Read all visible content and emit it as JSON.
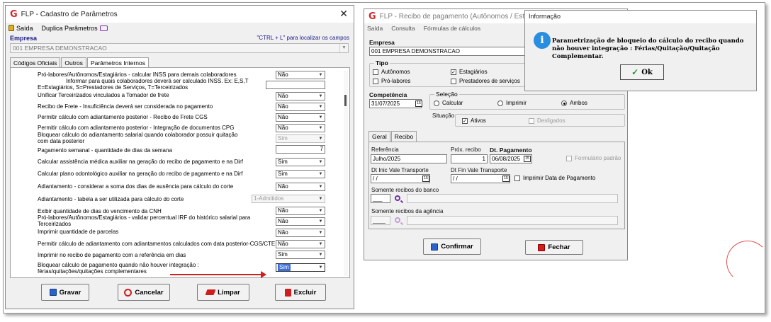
{
  "left": {
    "title": "FLP - Cadastro de Parâmetros",
    "menu": {
      "saida": "Saída",
      "duplica": "Duplica Parâmetros"
    },
    "empresa_label": "Empresa",
    "empresa_hint": "\"CTRL + L\" para localizar os campos",
    "empresa_value": "001 EMPRESA DEMONSTRACAO",
    "tabs": [
      "Códigos Oficiais",
      "Outros",
      "Parâmetros Internos"
    ],
    "rows": [
      {
        "label": "Pró-labores/Autônomos/Estagiários - calcular INSS para demais colaboradores",
        "value": "Não"
      },
      {
        "label": "Informar para quais colaboradores deverá ser calculado INSS. Ex: E,S,T",
        "value": ""
      },
      {
        "label": "E=Estagiários, S=Prestadores de Serviços, T=Terceirizados",
        "value": ""
      },
      {
        "label": "Unificar Terceirizados vinculados a Tomador de frete",
        "value": "Não"
      },
      {
        "label": "Recibo de Frete - Insuficiência deverá ser considerada no pagamento",
        "value": "Não"
      },
      {
        "label": "Permitir cálculo com adiantamento posterior - Recibo de Frete CGS",
        "value": "Não"
      },
      {
        "label": "Permitir cálculo com adiantamento posterior - Integração de documentos CPG",
        "value": "Não"
      },
      {
        "label": "Bloquear cálculo do adiantamento salarial quando colaborador possuir quitação",
        "value": "Sim"
      },
      {
        "label": "com data posterior",
        "value": ""
      },
      {
        "label": "Pagamento semanal - quantidade de dias da  semana",
        "value": "7"
      },
      {
        "label": "Calcular assistência médica auxiliar na geração do recibo de pagamento e na Dirf",
        "value": "Sim"
      },
      {
        "label": "Calcular plano odontológico auxiliar na geração do recibo de pagamento e na Dirf",
        "value": "Sim"
      },
      {
        "label": "Adiantamento - considerar a soma dos dias de ausência para cálculo do corte",
        "value": "Não"
      },
      {
        "label": "Adiantamento - tabela a ser utilizada para cálculo do corte",
        "value": "1-Admitidos"
      },
      {
        "label": "Exibir quantidade de dias do vencimento da CNH",
        "value": "Não"
      },
      {
        "label": "Pró-labores/Autônomos/Estagiários - validar percentual IRF do  histórico salarial para",
        "value": "Não"
      },
      {
        "label": "Terceirizados",
        "value": ""
      },
      {
        "label": "Imprimir quantidade de parcelas",
        "value": "Não"
      },
      {
        "label": "Permitir cálculo de adiantamento com adiantamentos calculados com data posterior-CGS/CTE",
        "value": "Não"
      },
      {
        "label": "Imprimir no recibo de pagamento com a referência em dias",
        "value": "Sim"
      },
      {
        "label": "Bloquear cálculo de pagamento quando não houver integração :",
        "value": "Sim"
      },
      {
        "label": "férias/quitações/quitações complementares",
        "value": ""
      }
    ],
    "buttons": {
      "gravar": "Gravar",
      "cancelar": "Cancelar",
      "limpar": "Limpar",
      "excluir": "Excluir"
    }
  },
  "right": {
    "title": "FLP - Recibo de pagamento (Autônomos / Estagiário",
    "menu": [
      "Saída",
      "Consulta",
      "Fórmulas de cálculos"
    ],
    "empresa_label": "Empresa",
    "empresa_value": "001 EMPRESA DEMONSTRACAO",
    "tipo_label": "Tipo",
    "tipo": {
      "autonomos": "Autônomos",
      "estagiarios": "Estagiários",
      "pro_labores": "Pró-labores",
      "prestadores": "Prestadores de serviços"
    },
    "competencia_label": "Competência",
    "competencia_value": "31/07/2025",
    "selecao_label": "Seleção",
    "selecao": {
      "calcular": "Calcular",
      "imprimir": "Imprimir",
      "ambos": "Ambos"
    },
    "situacao_label": "Situação",
    "situacao": {
      "ativos": "Ativos",
      "desligados": "Desligados"
    },
    "tabs": [
      "Geral",
      "Recibo"
    ],
    "referencia_label": "Referência",
    "referencia_value": "Julho/2025",
    "prox_recibo_label": "Próx. recibo",
    "prox_recibo_value": "1",
    "dt_pagamento_label": "Dt. Pagamento",
    "dt_pagamento_value": "06/08/2025",
    "formulario_padrao": "Formulário padrão",
    "dt_inic_label": "Dt Inic Vale Transporte",
    "dt_inic_value": " /  /",
    "dt_fin_label": "Dt Fin Vale Transporte",
    "dt_fin_value": " /  /",
    "imprimir_data": "Imprimir Data de Pagamento",
    "banco_label": "Somente recibos do banco",
    "banco_value": "___",
    "agencia_label": "Somente recibos da agência",
    "agencia_value": "____",
    "confirmar": "Confirmar",
    "fechar": "Fechar"
  },
  "dialog": {
    "title": "Informação",
    "message": "Parametrização de bloqueio do cálculo do recibo quando não houver integração : Férias/Quitação/Quitação Complementar.",
    "ok": "Ok"
  }
}
